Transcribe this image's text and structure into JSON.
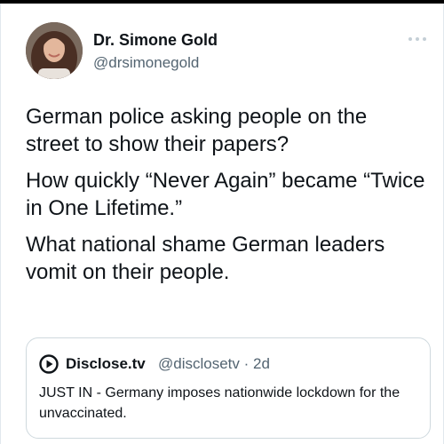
{
  "tweet": {
    "author": {
      "display_name": "Dr. Simone Gold",
      "handle": "@drsimonegold"
    },
    "more_icon": "more-horizontal-icon",
    "body": [
      "German police asking people on the street to show their papers?",
      "How quickly “Never Again” became “Twice in One Lifetime.”",
      "What national shame German leaders vomit on their people."
    ],
    "quoted": {
      "avatar_icon": "disclose-tv-logo-icon",
      "display_name": "Disclose.tv",
      "handle": "@disclosetv",
      "separator": "·",
      "time": "2d",
      "text": "JUST IN - Germany imposes nationwide lockdown for the unvaccinated."
    }
  },
  "colors": {
    "text_primary": "#0f1419",
    "text_secondary": "#536471",
    "border": "#cfd9de"
  }
}
